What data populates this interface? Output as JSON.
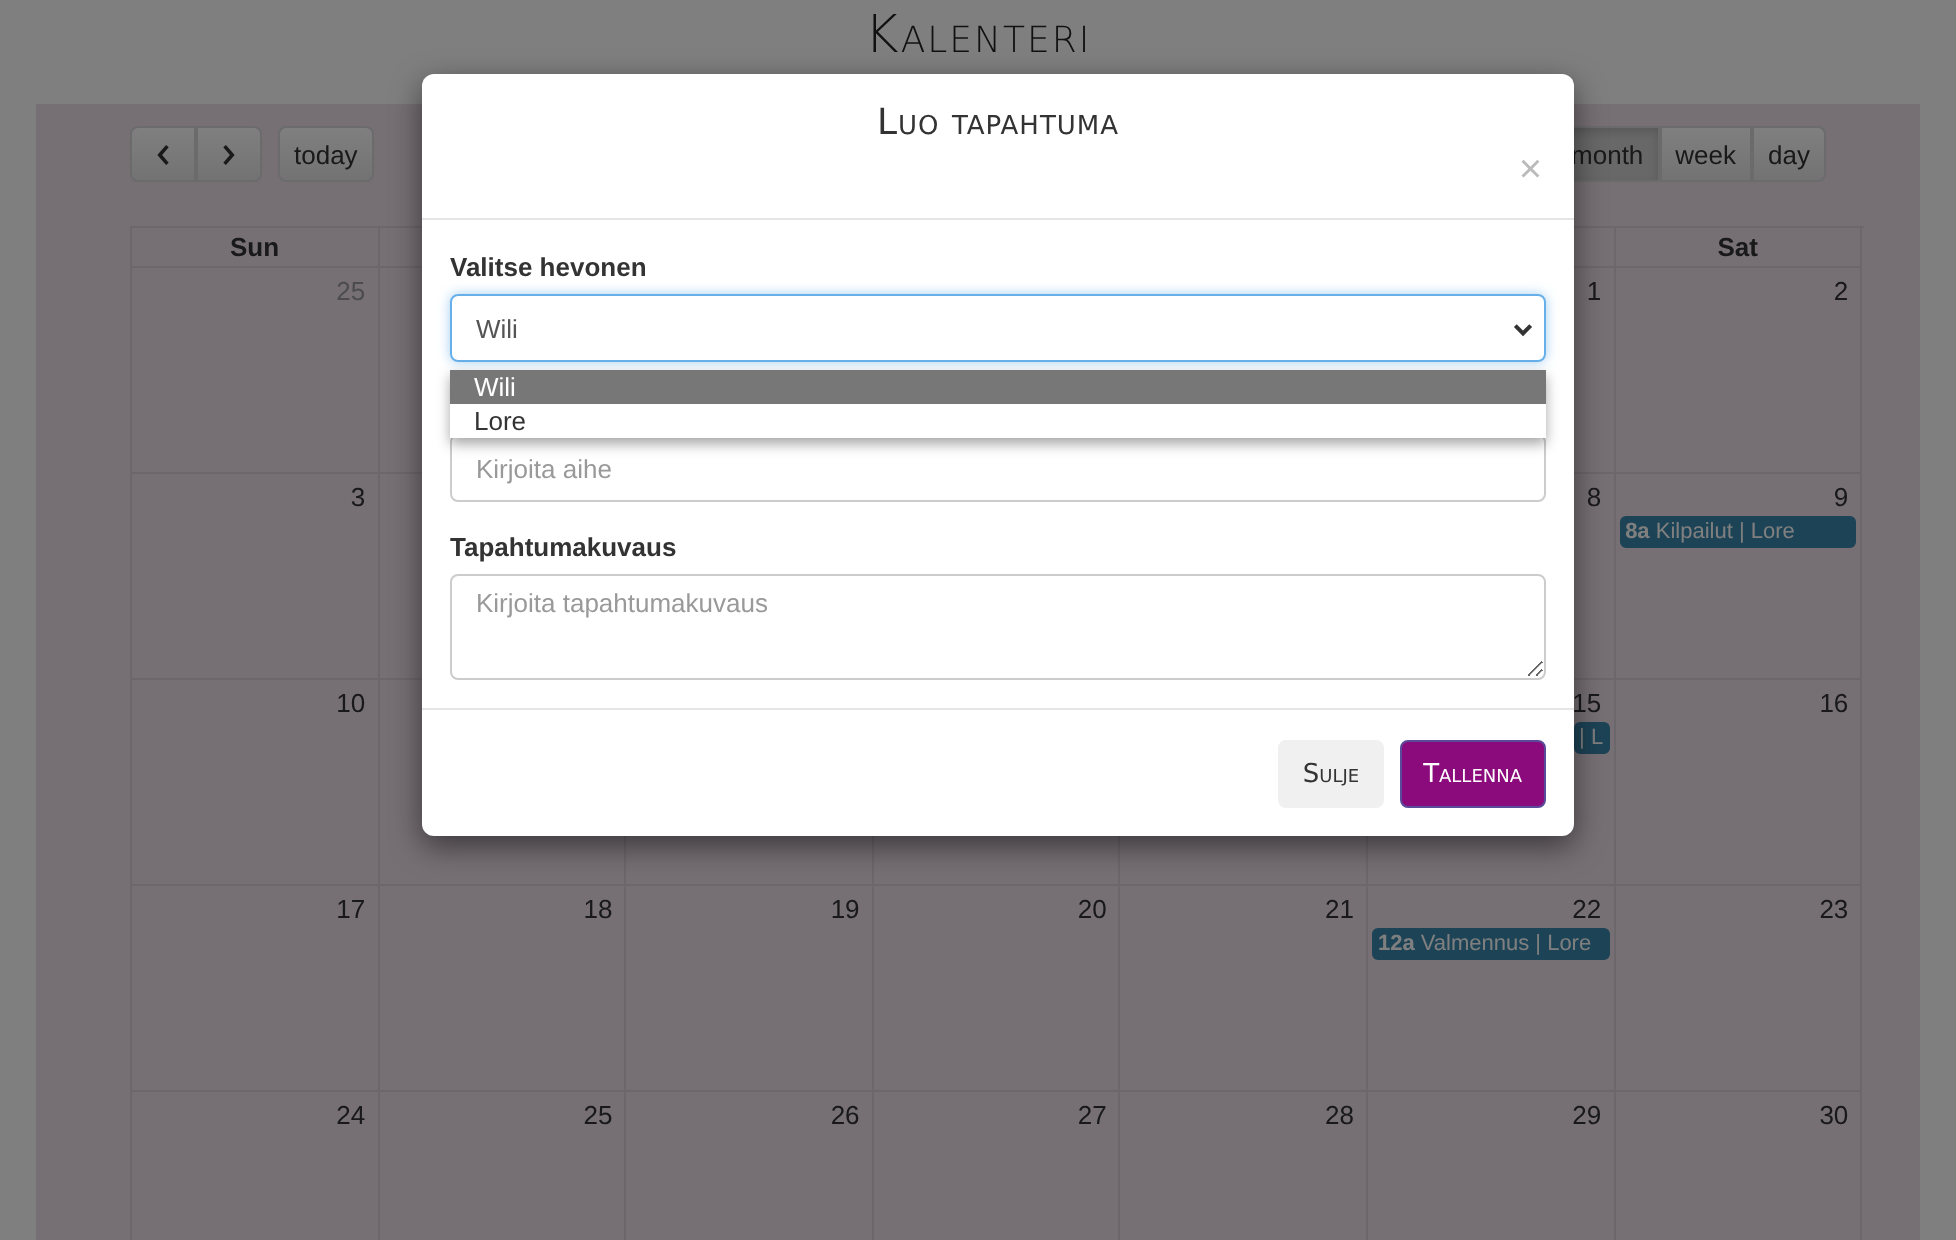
{
  "page": {
    "title": "Kalenteri"
  },
  "calendar": {
    "nav_buttons": [
      {
        "kind": "prev"
      },
      {
        "kind": "next"
      }
    ],
    "today_button": "today",
    "views": [
      {
        "label": "month",
        "selected": true
      },
      {
        "label": "week",
        "selected": false
      },
      {
        "label": "day",
        "selected": false
      }
    ],
    "weekdays": {
      "sun": "Sun",
      "sat": "Sat"
    },
    "weeks": [
      {
        "sun": {
          "date": "25",
          "other_month": true
        },
        "fri": {
          "date": "1",
          "other_month": false
        },
        "sat": {
          "date": "2",
          "other_month": false
        }
      },
      {
        "sun": {
          "date": "3",
          "other_month": false
        },
        "fri": {
          "date": "8",
          "other_month": false
        },
        "sat": {
          "date": "9",
          "other_month": false,
          "events": [
            {
              "text": "**8a** Kilpailut | Lore",
              "clipped": false
            }
          ]
        }
      },
      {
        "sun": {
          "date": "10",
          "other_month": false
        },
        "fri": {
          "date": "15",
          "other_month": false,
          "events": [
            {
              "text": "| L",
              "clipped": true
            }
          ]
        },
        "sat": {
          "date": "16",
          "other_month": false
        }
      },
      {
        "sun": {
          "date": "17",
          "other_month": false
        },
        "mon": {
          "date": "18",
          "other_month": false
        },
        "tue": {
          "date": "19",
          "other_month": false
        },
        "wed": {
          "date": "20",
          "other_month": false
        },
        "thu": {
          "date": "21",
          "other_month": false
        },
        "fri": {
          "date": "22",
          "other_month": false,
          "events": [
            {
              "text": "**12a** Valmennus | Lore",
              "clipped": false
            }
          ]
        },
        "sat": {
          "date": "23",
          "other_month": false
        }
      },
      {
        "sun": {
          "date": "24",
          "other_month": false
        },
        "mon": {
          "date": "25",
          "other_month": false
        },
        "tue": {
          "date": "26",
          "other_month": false
        },
        "wed": {
          "date": "27",
          "other_month": false
        },
        "thu": {
          "date": "28",
          "other_month": false
        },
        "fri": {
          "date": "29",
          "other_month": false
        },
        "sat": {
          "date": "30",
          "other_month": false
        }
      }
    ]
  },
  "modal": {
    "title": "Luo tapahtuma",
    "close": "×",
    "fields": [
      {
        "kind": "select",
        "label": "Valitse hevonen",
        "value": "Wili",
        "options": [
          {
            "label": "Wili",
            "selected": true
          },
          {
            "label": "Lore",
            "selected": false
          }
        ]
      },
      {
        "kind": "input",
        "placeholder": "Kirjoita aihe"
      },
      {
        "kind": "textarea",
        "label": "Tapahtumakuvaus",
        "placeholder": "Kirjoita tapahtumakuvaus"
      }
    ],
    "buttons": [
      {
        "label": "Sulje",
        "kind": "secondary"
      },
      {
        "label": "Tallenna",
        "kind": "primary"
      }
    ]
  }
}
